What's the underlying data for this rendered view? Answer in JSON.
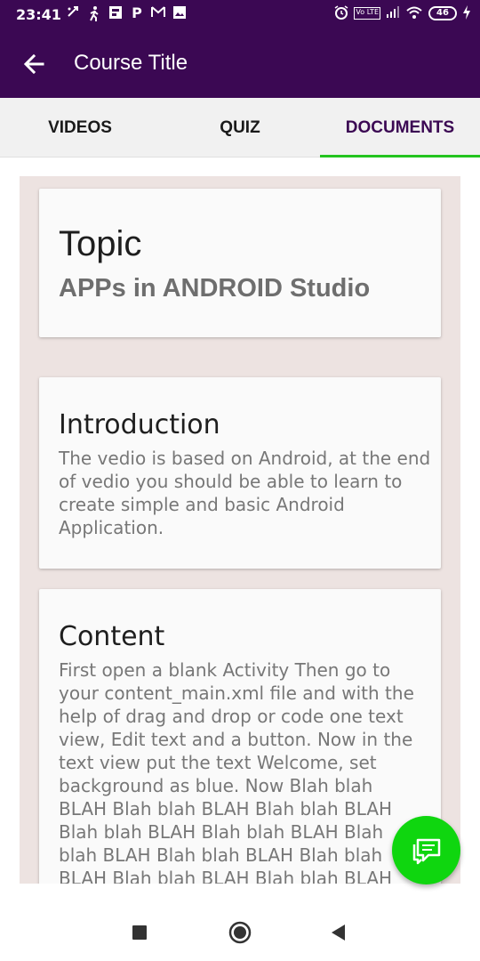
{
  "status_bar": {
    "time": "23:41",
    "battery": "46",
    "network_badge": "Vo LTE",
    "left_icons": [
      "missed-call-icon",
      "walking-icon",
      "app-icon",
      "paytm-icon",
      "gmail-icon",
      "gallery-icon"
    ],
    "right_icons": [
      "alarm-icon",
      "volte-icon",
      "signal-icon",
      "wifi-icon",
      "battery-icon",
      "charging-icon"
    ]
  },
  "app_bar": {
    "title": "Course Title",
    "back_icon": "arrow-left-icon",
    "color": "#3b0853"
  },
  "tabs": [
    {
      "label": "VIDEOS",
      "active": false
    },
    {
      "label": "QUIZ",
      "active": false
    },
    {
      "label": "DOCUMENTS",
      "active": true
    }
  ],
  "accent_color": "#23c41f",
  "cards": {
    "topic": {
      "heading": "Topic",
      "subtitle": "APPs in ANDROID Studio"
    },
    "introduction": {
      "heading": "Introduction",
      "body": "The vedio is based on Android, at the end of vedio you should be able to learn to create simple and basic Android Application."
    },
    "content": {
      "heading": "Content",
      "body": "First open a blank Activity Then go to your content_main.xml file and with the help of drag and drop or code one text view, Edit text and a button. Now in the text view put the text Welcome, set background as blue. Now Blah blah BLAH Blah blah BLAH Blah blah BLAH Blah blah BLAH Blah blah BLAH Blah blah BLAH Blah blah BLAH Blah blah BLAH Blah blah BLAH Blah blah BLAH Blah blah BLAH Blah blah BLAH Blah blah"
    }
  },
  "fab": {
    "icon": "chat-icon",
    "color": "#0fd60f"
  },
  "nav_bar": {
    "icons": [
      "recents-square-icon",
      "home-circle-icon",
      "back-triangle-icon"
    ]
  }
}
